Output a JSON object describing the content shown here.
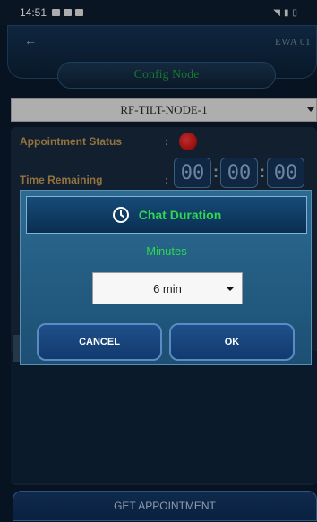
{
  "status_bar": {
    "time": "14:51"
  },
  "header": {
    "device_id": "EWA 01"
  },
  "config": {
    "title": "Config Node",
    "node": "RF-TILT-NODE-1"
  },
  "appointment": {
    "status_label": "Appointment Status",
    "status_colon": ":",
    "time_label": "Time Remaining",
    "time_colon": ":",
    "hours": "00",
    "minutes": "00",
    "seconds": "00",
    "sep": ":"
  },
  "dialog": {
    "title": "Chat Duration",
    "minutes_label": "Minutes",
    "selected": "6 min",
    "cancel": "CANCEL",
    "ok": "OK"
  },
  "footer": {
    "get_appointment": "GET APPOINTMENT"
  }
}
